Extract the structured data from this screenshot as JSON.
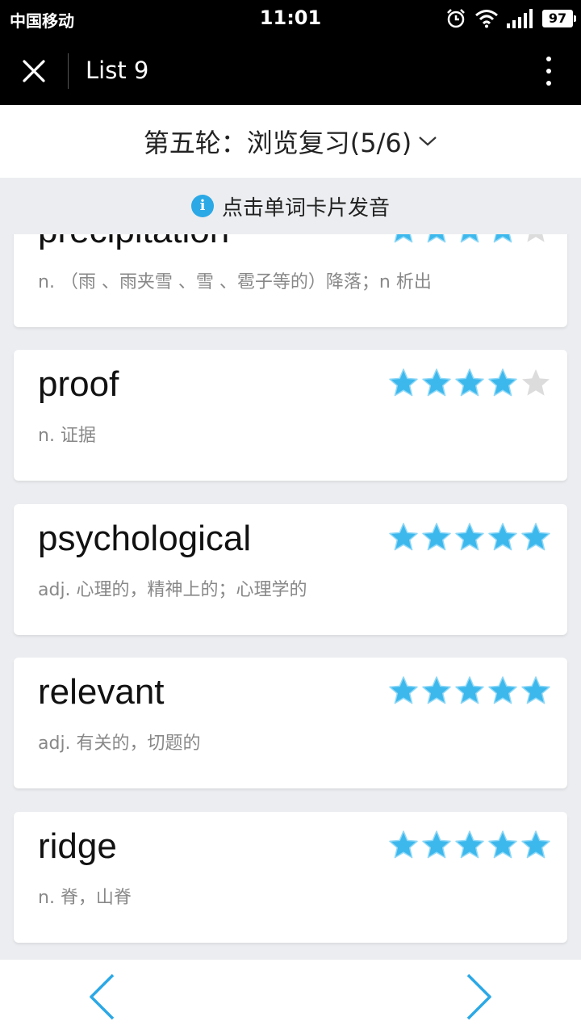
{
  "status_bar": {
    "carrier": "中国移动",
    "time": "11:01",
    "battery": "97",
    "icons": [
      "alarm-icon",
      "wifi-icon",
      "signal-icon",
      "battery-icon"
    ]
  },
  "app_bar": {
    "title": "List 9",
    "close_icon": "close-icon",
    "more_icon": "more-vertical-icon"
  },
  "round": {
    "title": "第五轮：浏览复习(5/6)",
    "dropdown_icon": "chevron-down-icon"
  },
  "hint": {
    "text": "点击单词卡片发音",
    "icon": "info-icon"
  },
  "colors": {
    "accent": "#2ba8e6",
    "star_filled": "#3cb8ec",
    "star_empty": "#dcdcdc"
  },
  "words": [
    {
      "word": "precipitation",
      "definition": "n. （雨 、雨夹雪 、雪 、雹子等的）降落；n 析出",
      "rating": 4
    },
    {
      "word": "proof",
      "definition": "n. 证据",
      "rating": 4
    },
    {
      "word": "psychological",
      "definition": "adj. 心理的，精神上的；心理学的",
      "rating": 5
    },
    {
      "word": "relevant",
      "definition": "adj. 有关的，切题的",
      "rating": 5
    },
    {
      "word": "ridge",
      "definition": "n. 脊，山脊",
      "rating": 5
    }
  ],
  "nav": {
    "prev_icon": "chevron-left-icon",
    "next_icon": "chevron-right-icon"
  }
}
